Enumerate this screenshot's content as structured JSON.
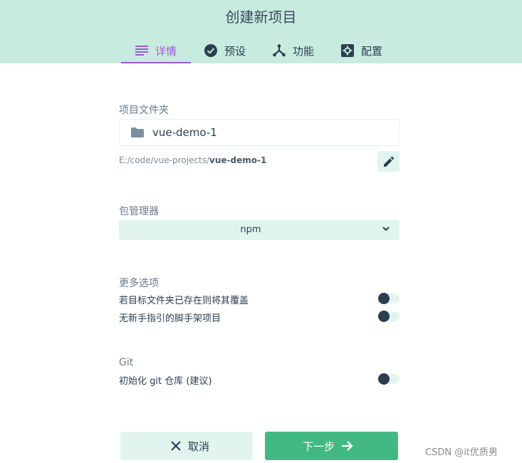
{
  "header": {
    "title": "创建新项目",
    "tabs": [
      {
        "label": "详情",
        "icon": "list-icon",
        "active": true
      },
      {
        "label": "预设",
        "icon": "check-circle-icon",
        "active": false
      },
      {
        "label": "功能",
        "icon": "merge-icon",
        "active": false
      },
      {
        "label": "配置",
        "icon": "settings-box-icon",
        "active": false
      }
    ]
  },
  "folder": {
    "section_label": "项目文件夹",
    "name": "vue-demo-1",
    "path_prefix": "E:/code/vue-projects/",
    "path_name": "vue-demo-1",
    "icon": "folder-icon",
    "edit_icon": "pencil-icon"
  },
  "package_manager": {
    "section_label": "包管理器",
    "selected": "npm"
  },
  "more_options": {
    "section_label": "更多选项",
    "options": [
      {
        "label": "若目标文件夹已存在则将其覆盖",
        "enabled": false
      },
      {
        "label": "无新手指引的脚手架项目",
        "enabled": false
      }
    ]
  },
  "git": {
    "section_label": "Git",
    "option_label": "初始化 git 仓库 (建议)",
    "enabled": false
  },
  "buttons": {
    "cancel": "取消",
    "next": "下一步"
  },
  "colors": {
    "header_bg": "#c8ebe0",
    "accent_purple": "#9c5bd6",
    "primary_green": "#42b983",
    "light_green": "#e1f5ee"
  },
  "watermark": "CSDN @it优质男"
}
